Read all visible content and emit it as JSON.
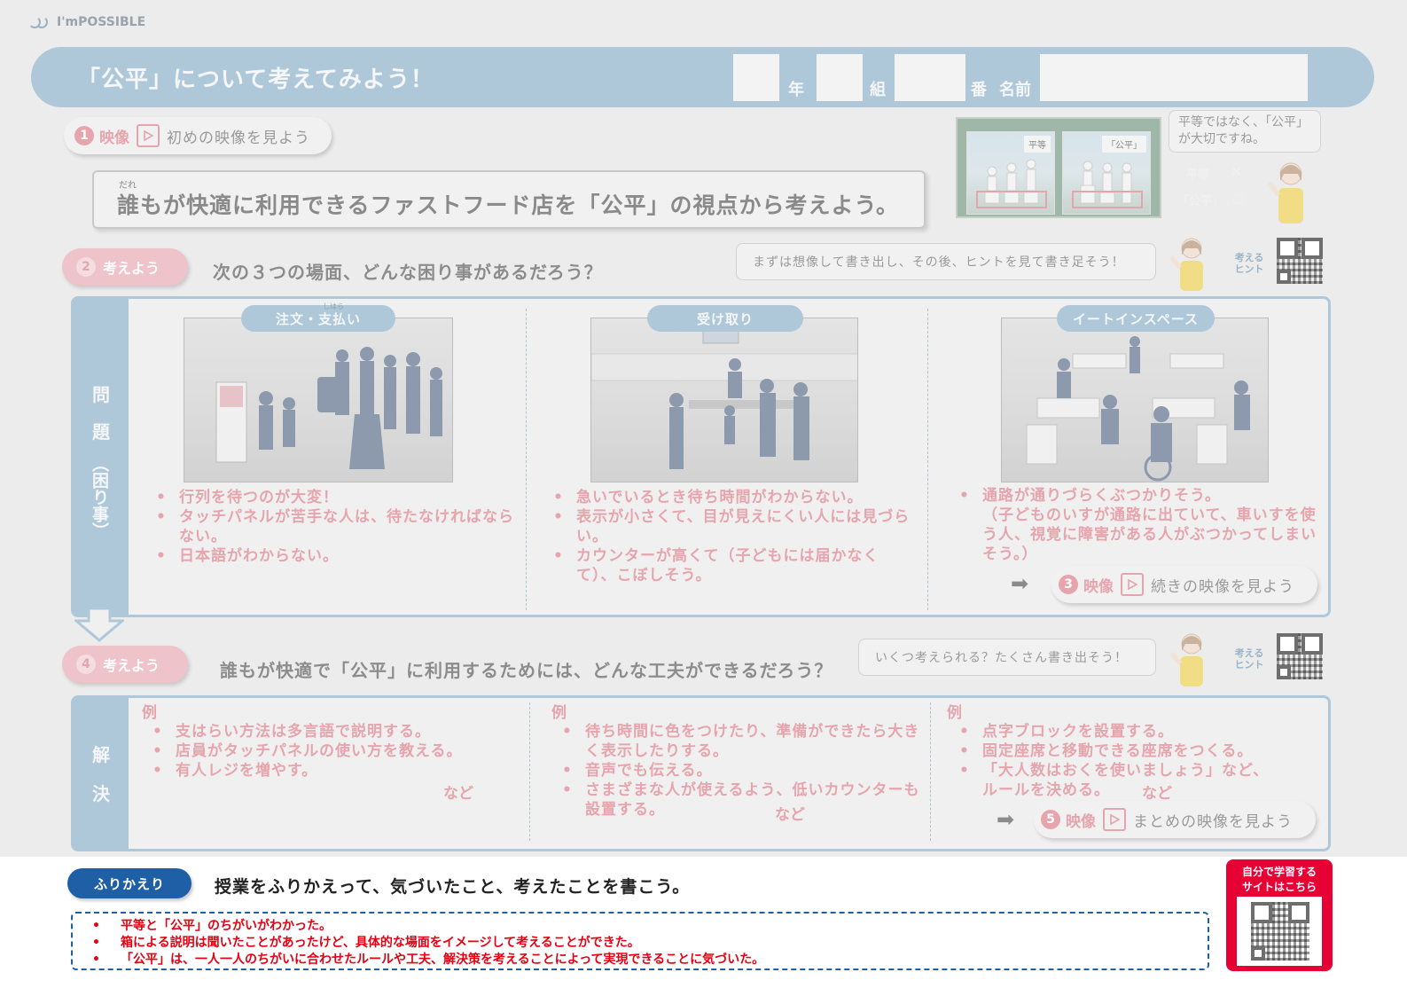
{
  "logo": {
    "text": "I'mPOSSIBLE"
  },
  "header": {
    "title": "「公平」について考えてみよう！",
    "fields": {
      "year_label": "年",
      "class_label": "組",
      "number_label": "番",
      "name_label": "名前"
    }
  },
  "step1": {
    "number": "1",
    "video_label": "映像",
    "text": "初めの映像を見よう"
  },
  "main_question": {
    "ruby": "だれ",
    "text": "誰もが快適に利用できるファストフード店を「公平」の視点から考えよう。"
  },
  "intro_panel": {
    "left_tag": "平等",
    "right_tag": "「公平」",
    "equal_label": "平等",
    "equal_mark": "✕",
    "fair_label": "「公平」",
    "fair_mark": "○",
    "bubble": "平等ではなく、「公平」が大切ですね。"
  },
  "step2": {
    "number": "2",
    "label": "考えよう",
    "question": "次の３つの場面、どんな困り事があるだろう？",
    "hint_bubble": "まずは想像して書き出し、その後、ヒントを見て書き足そう！",
    "hint_label": "考える\nヒント"
  },
  "problems": {
    "side_label": [
      "問",
      "題",
      "（困り事）"
    ],
    "scenes": [
      {
        "tag": "注文・支払い",
        "tag_ruby": "しはら",
        "items": [
          "行列を待つのが大変！",
          "タッチパネルが苦手な人は、待たなければならない。",
          "日本語がわからない。"
        ]
      },
      {
        "tag": "受け取り",
        "items": [
          "急いでいるとき待ち時間がわからない。",
          "表示が小さくて、目が見えにくい人には見づらい。",
          "カウンターが高くて（子どもには届かなくて）、こぼしそう。"
        ]
      },
      {
        "tag": "イートインスペース",
        "items": [
          "通路が通りづらくぶつかりそう。",
          "（子どものいすが通路に出ていて、車いすを使う人、視覚に障害がある人がぶつかってしまいそう。）"
        ]
      }
    ],
    "step3": {
      "number": "3",
      "video_label": "映像",
      "text": "続きの映像を見よう"
    }
  },
  "step4": {
    "number": "4",
    "label": "考えよう",
    "question": "誰もが快適で「公平」に利用するためには、どんな工夫ができるだろう？",
    "hint_bubble": "いくつ考えられる？たくさん書き出そう！",
    "hint_label": "考える\nヒント"
  },
  "solutions": {
    "side_label": [
      "解",
      "決"
    ],
    "columns": [
      {
        "example": "例",
        "items": [
          "支はらい方法は多言語で説明する。",
          "店員がタッチパネルの使い方を教える。",
          "有人レジを増やす。"
        ],
        "etc": "など"
      },
      {
        "example": "例",
        "items": [
          "待ち時間に色をつけたり、準備ができたら大きく表示したりする。",
          "音声でも伝える。",
          "さまざまな人が使えるよう、低いカウンターも設置する。"
        ],
        "etc": "など"
      },
      {
        "example": "例",
        "items": [
          "点字ブロックを設置する。",
          "固定座席と移動できる座席をつくる。",
          "「大人数はおくを使いましょう」など、ルールを決める。"
        ],
        "etc": "など"
      }
    ],
    "step5": {
      "number": "5",
      "video_label": "映像",
      "text": "まとめの映像を見よう"
    }
  },
  "reflection": {
    "label": "ふりかえり",
    "question": "授業をふりかえって、気づいたこと、考えたことを書こう。",
    "items": [
      "平等と「公平」のちがいがわかった。",
      "箱による説明は聞いたことがあったけど、具体的な場面をイメージして考えることができた。",
      "「公平」は、一人一人のちがいに合わせたルールや工夫、解決策を考えることによって実現できることに気づいた。"
    ]
  },
  "self_study": {
    "text": "自分で学習するサイトはこちら"
  },
  "colors": {
    "banner": "#aec8d9",
    "accent_pink": "#e6a5ad",
    "reflection_blue": "#1e5fa6",
    "answer_red": "#e60012",
    "self_study_red": "#e60033"
  }
}
